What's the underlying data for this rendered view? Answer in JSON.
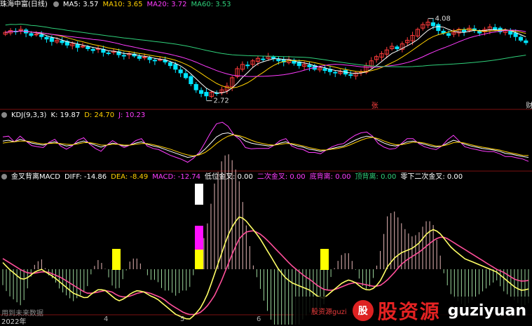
{
  "panel1": {
    "title": "珠海中富(日线)",
    "ma5_label": "MA5: 3.57",
    "ma10_label": "MA10: 3.65",
    "ma20_label": "MA20: 3.72",
    "ma60_label": "MA60: 3.53",
    "high_label": "4.08",
    "low_label": "2.72",
    "mark_zhang": "张",
    "mark_cai": "财",
    "colors": {
      "ma5": "#ffffff",
      "ma10": "#ffd000",
      "ma20": "#ff3cff",
      "ma60": "#2fd07a",
      "up": "#ff3b3b",
      "down": "#00e5ff"
    }
  },
  "panel2": {
    "title": "KDJ(9,3,3)",
    "k_label": "K: 19.87",
    "d_label": "D: 24.70",
    "j_label": "J: 10.23",
    "colors": {
      "k": "#ffffff",
      "d": "#ffd000",
      "j": "#ff3cff"
    }
  },
  "panel3": {
    "title": "金叉背离MACD",
    "diff_label": "DIFF: -14.86",
    "dea_label": "DEA: -8.49",
    "macd_label": "MACD: -12.74",
    "low_cross": "低位金叉: 0.00",
    "second_cross": "二次金叉: 0.00",
    "bottom_div": "底背离: 0.00",
    "top_div": "顶背离: 0.00",
    "zero_cross": "零下二次金叉: 0.00",
    "footer_left": "用到未来数据",
    "colors": {
      "diff": "#ffff66",
      "dea": "#ff4f9a",
      "bar_pos": "#e8b8b8",
      "bar_neg": "#9bd59b"
    }
  },
  "axis": {
    "year_label": "2022年",
    "months": [
      "4",
      "5",
      "6"
    ]
  },
  "watermark": {
    "small": "股资源guzi",
    "seal": "股",
    "big": "股资源",
    "en": "guziyuan"
  },
  "chart_data": [
    {
      "type": "candlestick",
      "title": "珠海中富(日线)",
      "series": [
        {
          "name": "MA5",
          "value": 3.57
        },
        {
          "name": "MA10",
          "value": 3.65
        },
        {
          "name": "MA20",
          "value": 3.72
        },
        {
          "name": "MA60",
          "value": 3.53
        }
      ],
      "annotations": [
        {
          "label": "4.08",
          "value": 4.08
        },
        {
          "label": "2.72",
          "value": 2.72
        }
      ],
      "ylim": [
        2.6,
        4.2
      ],
      "close": [
        3.85,
        3.88,
        3.86,
        3.9,
        3.84,
        3.8,
        3.82,
        3.78,
        3.74,
        3.7,
        3.72,
        3.68,
        3.64,
        3.66,
        3.6,
        3.62,
        3.58,
        3.55,
        3.58,
        3.52,
        3.5,
        3.54,
        3.48,
        3.46,
        3.5,
        3.46,
        3.42,
        3.44,
        3.4,
        3.38,
        3.4,
        3.36,
        3.3,
        3.24,
        3.18,
        3.1,
        3.0,
        2.9,
        2.84,
        2.8,
        2.86,
        2.84,
        2.9,
        2.96,
        3.1,
        3.25,
        3.32,
        3.3,
        3.38,
        3.42,
        3.4,
        3.45,
        3.42,
        3.38,
        3.36,
        3.4,
        3.34,
        3.3,
        3.32,
        3.28,
        3.24,
        3.26,
        3.22,
        3.2,
        3.18,
        3.2,
        3.16,
        3.14,
        3.18,
        3.2,
        3.3,
        3.38,
        3.45,
        3.5,
        3.56,
        3.62,
        3.58,
        3.66,
        3.72,
        3.8,
        3.9,
        3.98,
        4.02,
        3.96,
        3.88,
        3.84,
        3.8,
        3.85,
        3.9,
        3.86,
        3.92,
        3.88,
        3.84,
        3.9,
        3.94,
        3.9,
        3.86,
        3.88,
        3.82,
        3.78,
        3.72,
        3.68
      ]
    },
    {
      "type": "line",
      "title": "KDJ(9,3,3)",
      "series": [
        {
          "name": "K",
          "last": 19.87
        },
        {
          "name": "D",
          "last": 24.7
        },
        {
          "name": "J",
          "last": 10.23
        }
      ],
      "k": [
        60,
        62,
        58,
        64,
        60,
        55,
        52,
        50,
        55,
        58,
        52,
        48,
        50,
        56,
        60,
        55,
        50,
        45,
        50,
        55,
        52,
        48,
        50,
        55,
        58,
        52,
        48,
        45,
        40,
        35,
        30,
        25,
        20,
        22,
        28,
        40,
        55,
        70,
        78,
        80,
        75,
        70,
        60,
        55,
        52,
        50,
        48,
        50,
        55,
        58,
        52,
        48,
        45,
        40,
        38,
        35,
        38,
        42,
        45,
        48,
        55,
        62,
        68,
        72,
        70,
        62,
        55,
        50,
        48,
        52,
        58,
        60,
        56,
        52,
        48,
        45,
        48,
        55,
        62,
        58,
        52,
        48,
        45,
        42,
        40,
        38,
        35,
        30,
        28,
        25,
        22,
        20
      ],
      "d": [
        55,
        57,
        58,
        60,
        60,
        58,
        55,
        53,
        54,
        55,
        54,
        52,
        51,
        53,
        56,
        56,
        54,
        50,
        50,
        52,
        52,
        50,
        50,
        52,
        54,
        54,
        51,
        48,
        44,
        40,
        35,
        30,
        26,
        24,
        26,
        32,
        42,
        54,
        64,
        72,
        75,
        73,
        68,
        62,
        57,
        54,
        51,
        50,
        52,
        54,
        54,
        51,
        48,
        44,
        41,
        38,
        38,
        40,
        42,
        45,
        50,
        56,
        62,
        67,
        69,
        66,
        60,
        55,
        51,
        51,
        54,
        57,
        57,
        55,
        51,
        48,
        48,
        51,
        56,
        57,
        55,
        51,
        48,
        45,
        43,
        40,
        38,
        34,
        31,
        28,
        25,
        24.7
      ],
      "j": [
        70,
        72,
        58,
        72,
        60,
        49,
        46,
        44,
        57,
        64,
        48,
        40,
        48,
        62,
        68,
        53,
        42,
        35,
        50,
        61,
        52,
        44,
        50,
        61,
        66,
        48,
        42,
        39,
        32,
        25,
        20,
        15,
        8,
        18,
        32,
        56,
        81,
        102,
        106,
        96,
        75,
        64,
        44,
        41,
        42,
        42,
        42,
        50,
        61,
        66,
        48,
        42,
        39,
        32,
        32,
        29,
        38,
        46,
        51,
        54,
        65,
        74,
        80,
        82,
        72,
        54,
        45,
        40,
        42,
        54,
        66,
        66,
        54,
        46,
        42,
        39,
        48,
        63,
        74,
        60,
        46,
        42,
        39,
        36,
        34,
        34,
        29,
        22,
        22,
        19,
        16,
        10.23
      ]
    },
    {
      "type": "bar",
      "title": "金叉背离MACD",
      "series": [
        {
          "name": "DIFF",
          "last": -14.86
        },
        {
          "name": "DEA",
          "last": -8.49
        },
        {
          "name": "MACD",
          "last": -12.74
        }
      ],
      "diff": [
        5,
        0,
        -4,
        -8,
        -6,
        -2,
        0,
        -3,
        -6,
        -10,
        -14,
        -18,
        -20,
        -22,
        -18,
        -15,
        -16,
        -20,
        -24,
        -22,
        -18,
        -16,
        -17,
        -20,
        -22,
        -26,
        -30,
        -34,
        -36,
        -38,
        -34,
        -28,
        -18,
        -4,
        10,
        24,
        34,
        40,
        36,
        30,
        24,
        16,
        8,
        0,
        -6,
        -10,
        -12,
        -14,
        -16,
        -20,
        -22,
        -18,
        -14,
        -10,
        -8,
        -10,
        -14,
        -16,
        -14,
        -8,
        2,
        8,
        12,
        14,
        16,
        20,
        26,
        30,
        28,
        22,
        16,
        12,
        8,
        6,
        4,
        2,
        0,
        -2,
        -6,
        -10,
        -14,
        -16,
        -14.86
      ],
      "dea": [
        8,
        5,
        2,
        -1,
        -3,
        -3,
        -2,
        -2,
        -4,
        -6,
        -9,
        -12,
        -15,
        -18,
        -18,
        -17,
        -16,
        -17,
        -20,
        -21,
        -20,
        -18,
        -17,
        -18,
        -20,
        -22,
        -26,
        -29,
        -32,
        -34,
        -34,
        -32,
        -27,
        -20,
        -10,
        2,
        14,
        24,
        28,
        29,
        27,
        23,
        18,
        13,
        8,
        3,
        -1,
        -5,
        -8,
        -12,
        -15,
        -16,
        -15,
        -13,
        -11,
        -10,
        -11,
        -12,
        -13,
        -12,
        -8,
        -3,
        3,
        7,
        10,
        13,
        17,
        21,
        24,
        24,
        21,
        18,
        15,
        12,
        9,
        6,
        3,
        0,
        -2,
        -5,
        -8,
        -9,
        -8.49
      ],
      "special_bars": [
        {
          "name": "低位金叉",
          "color": "white"
        },
        {
          "name": "二次金叉",
          "color": "magenta"
        },
        {
          "name": "底背离",
          "color": "yellow"
        }
      ]
    }
  ]
}
